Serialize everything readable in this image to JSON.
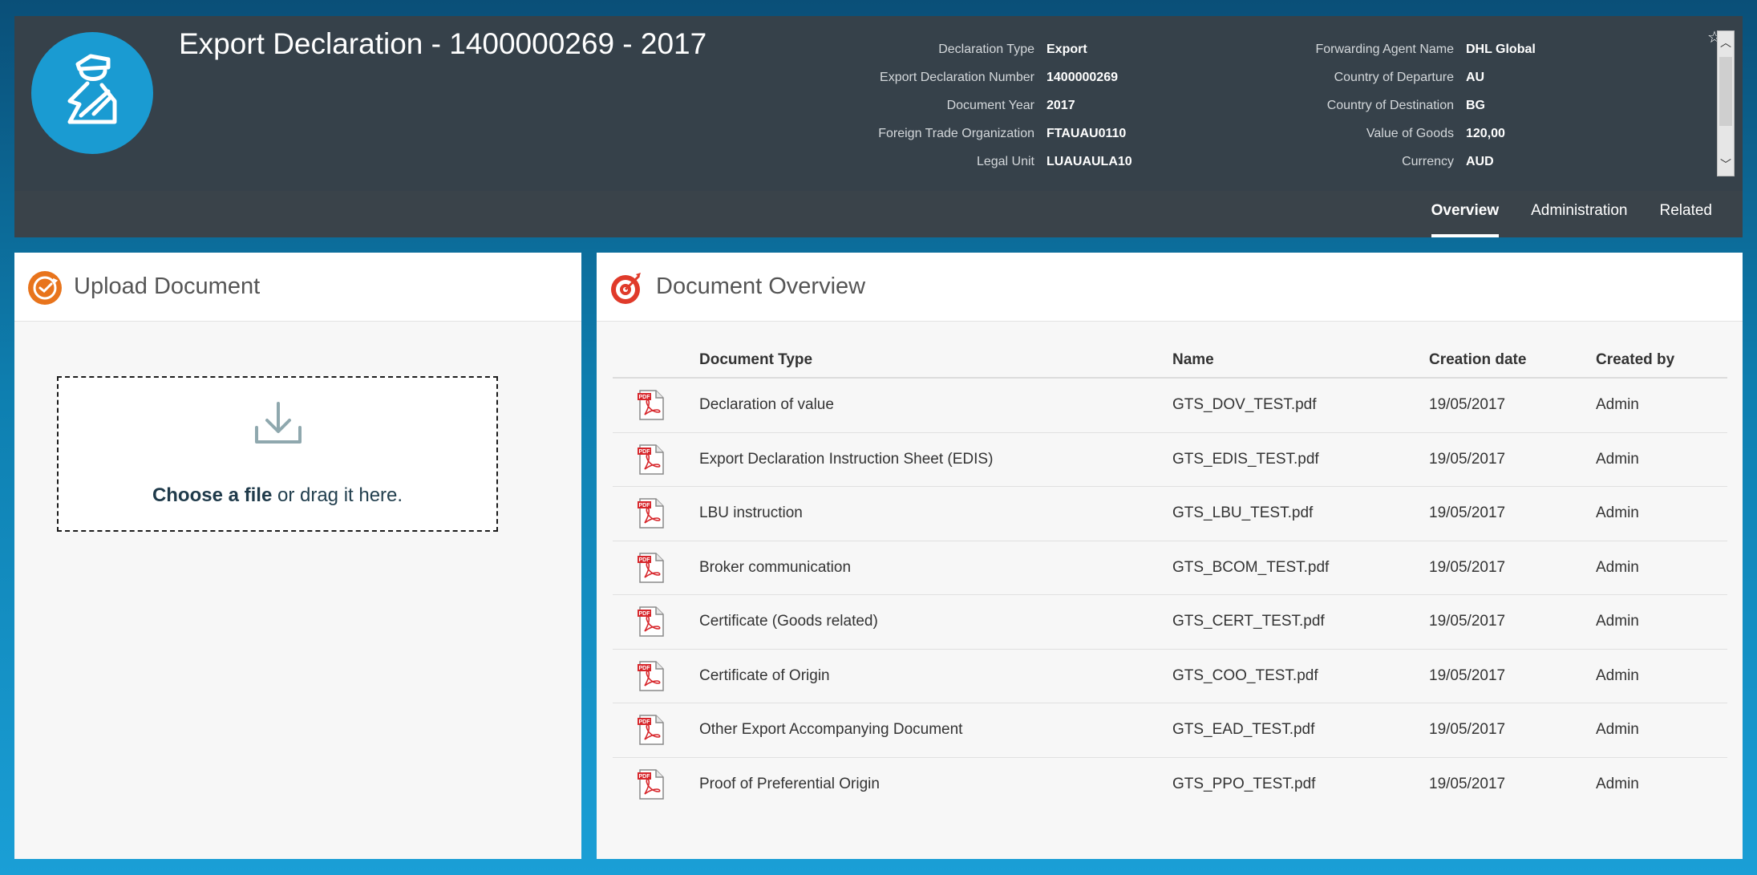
{
  "header": {
    "title": "Export Declaration - 1400000269 - 2017",
    "attributes_left": [
      {
        "label": "Declaration Type",
        "value": "Export"
      },
      {
        "label": "Export Declaration Number",
        "value": "1400000269"
      },
      {
        "label": "Document Year",
        "value": "2017"
      },
      {
        "label": "Foreign Trade Organization",
        "value": "FTAUAU0110"
      },
      {
        "label": "Legal Unit",
        "value": "LUAUAULA10"
      }
    ],
    "attributes_right": [
      {
        "label": "Forwarding Agent Name",
        "value": "DHL Global"
      },
      {
        "label": "Country of Departure",
        "value": "AU"
      },
      {
        "label": "Country of Destination",
        "value": "BG"
      },
      {
        "label": "Value of Goods",
        "value": "120,00"
      },
      {
        "label": "Currency",
        "value": "AUD"
      }
    ],
    "tabs": [
      {
        "label": "Overview",
        "active": true
      },
      {
        "label": "Administration",
        "active": false
      },
      {
        "label": "Related",
        "active": false
      }
    ]
  },
  "upload": {
    "title": "Upload Document",
    "choose_label": "Choose a file",
    "drag_label": " or drag it here."
  },
  "overview": {
    "title": "Document Overview",
    "columns": [
      "Document Type",
      "Name",
      "Creation date",
      "Created by"
    ],
    "rows": [
      {
        "type": "Declaration of value",
        "name": "GTS_DOV_TEST.pdf",
        "date": "19/05/2017",
        "by": "Admin"
      },
      {
        "type": "Export Declaration Instruction Sheet (EDIS)",
        "name": "GTS_EDIS_TEST.pdf",
        "date": "19/05/2017",
        "by": "Admin"
      },
      {
        "type": "LBU instruction",
        "name": "GTS_LBU_TEST.pdf",
        "date": "19/05/2017",
        "by": "Admin"
      },
      {
        "type": "Broker communication",
        "name": "GTS_BCOM_TEST.pdf",
        "date": "19/05/2017",
        "by": "Admin"
      },
      {
        "type": "Certificate (Goods related)",
        "name": "GTS_CERT_TEST.pdf",
        "date": "19/05/2017",
        "by": "Admin"
      },
      {
        "type": "Certificate of Origin",
        "name": "GTS_COO_TEST.pdf",
        "date": "19/05/2017",
        "by": "Admin"
      },
      {
        "type": "Other Export Accompanying Document",
        "name": "GTS_EAD_TEST.pdf",
        "date": "19/05/2017",
        "by": "Admin"
      },
      {
        "type": "Proof of Preferential Origin",
        "name": "GTS_PPO_TEST.pdf",
        "date": "19/05/2017",
        "by": "Admin"
      }
    ],
    "row_icon": "pdf-icon",
    "pdf_icon_text": "PDF"
  },
  "colors": {
    "header_bg": "#36414a",
    "avatar_bg": "#1a9bd2",
    "upload_icon": "#e8741c",
    "overview_icon": "#e03a2a"
  }
}
